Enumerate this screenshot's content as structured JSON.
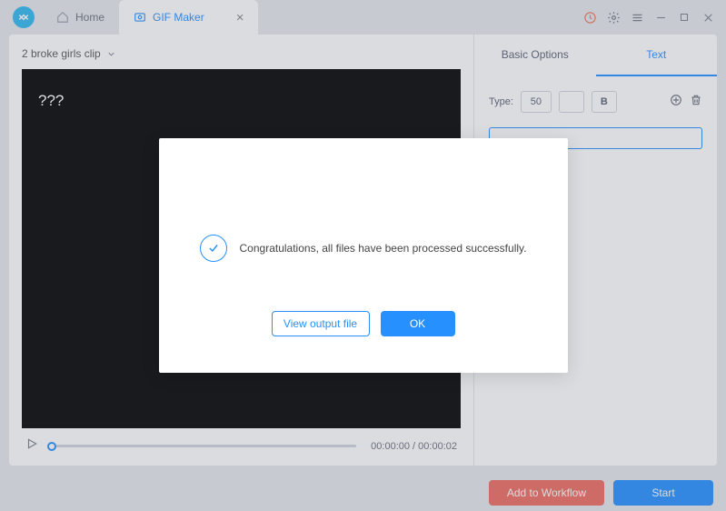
{
  "titlebar": {
    "home_tab": "Home",
    "active_tab": "GIF Maker"
  },
  "file_selector": {
    "label": "2 broke girls clip"
  },
  "video": {
    "overlay_text": "???"
  },
  "player": {
    "current_time": "00:00:00",
    "total_time": "00:00:02"
  },
  "options": {
    "tab_basic": "Basic Options",
    "tab_text": "Text",
    "type_label": "Type:",
    "size_value": "50",
    "bold_label": "B",
    "text_value": ""
  },
  "footer": {
    "workflow_label": "Add to Workflow",
    "start_label": "Start"
  },
  "modal": {
    "message": "Congratulations, all files have been processed successfully.",
    "view_output": "View output file",
    "ok": "OK"
  }
}
